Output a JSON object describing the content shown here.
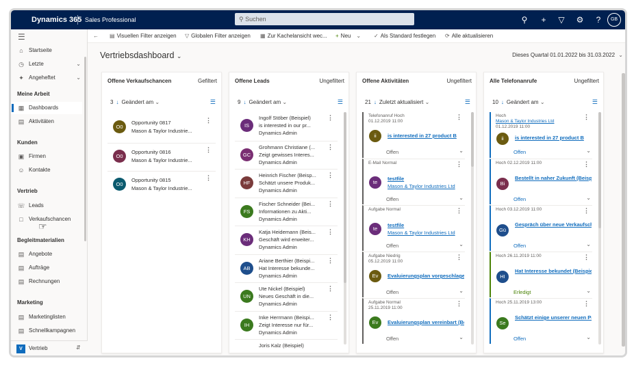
{
  "topbar": {
    "brand": "Dynamics 365",
    "app_name": "Sales Professional",
    "search_placeholder": "Suchen",
    "user_initials": "GB"
  },
  "sidebar": {
    "nav": [
      {
        "label": "Startseite",
        "icon": "home-icon"
      },
      {
        "label": "Letzte",
        "icon": "clock-icon"
      },
      {
        "label": "Angeheftet",
        "icon": "pin-icon"
      }
    ],
    "sections": [
      {
        "title": "Meine Arbeit",
        "items": [
          {
            "label": "Dashboards",
            "icon": "dashboard-icon"
          },
          {
            "label": "Aktivitäten",
            "icon": "activity-icon"
          }
        ]
      },
      {
        "title": "Kunden",
        "items": [
          {
            "label": "Firmen",
            "icon": "building-icon"
          },
          {
            "label": "Kontakte",
            "icon": "person-icon"
          }
        ]
      },
      {
        "title": "Vertrieb",
        "items": [
          {
            "label": "Leads",
            "icon": "phone-icon"
          },
          {
            "label": "Verkaufschancen",
            "icon": "opportunity-icon"
          }
        ]
      },
      {
        "title": "Begleitmaterialien",
        "items": [
          {
            "label": "Angebote",
            "icon": "quote-icon"
          },
          {
            "label": "Aufträge",
            "icon": "order-icon"
          },
          {
            "label": "Rechnungen",
            "icon": "invoice-icon"
          }
        ]
      },
      {
        "title": "Marketing",
        "items": [
          {
            "label": "Marketinglisten",
            "icon": "list-icon"
          },
          {
            "label": "Schnellkampagnen",
            "icon": "campaign-icon"
          }
        ]
      }
    ],
    "area": {
      "badge": "V",
      "label": "Vertrieb"
    }
  },
  "commandbar": {
    "visual_filter": "Visuellen Filter anzeigen",
    "global_filter": "Globalen Filter anzeigen",
    "tile_view": "Zur Kachelansicht wec...",
    "new": "Neu",
    "set_default": "Als Standard festlegen",
    "refresh_all": "Alle aktualisieren"
  },
  "dashboard": {
    "title": "Vertriebsdashboard",
    "period": "Dieses Quartal 01.01.2022 bis 31.03.2022"
  },
  "cards": [
    {
      "title": "Offene Verkaufschancen",
      "filter": "Gefiltert",
      "count": "3",
      "sort": "Geändert am",
      "records": [
        {
          "initials": "O0",
          "color": "#6b5b10",
          "line1": "Opportunity 0817",
          "line2": "Mason & Taylor Industrie..."
        },
        {
          "initials": "O0",
          "color": "#7a2e4d",
          "line1": "Opportunity 0816",
          "line2": "Mason & Taylor Industrie..."
        },
        {
          "initials": "O0",
          "color": "#0b5a6e",
          "line1": "Opportunity 0815",
          "line2": "Mason & Taylor Industrie..."
        }
      ]
    },
    {
      "title": "Offene Leads",
      "filter": "Ungefiltert",
      "count": "9",
      "sort": "Geändert am",
      "records": [
        {
          "initials": "IS",
          "color": "#6b2d7a",
          "line1": "Ingolf Stöber (Beispiel)",
          "line2": "is interested in our pr...",
          "line3": "Dynamics Admin"
        },
        {
          "initials": "GC",
          "color": "#7a2e72",
          "line1": "Grohmann Christiane (...",
          "line2": "Zeigt gewisses Interes...",
          "line3": "Dynamics Admin"
        },
        {
          "initials": "HF",
          "color": "#7a3b3b",
          "line1": "Heinrich Fischer (Beisp...",
          "line2": "Schätzt unsere Produk...",
          "line3": "Dynamics Admin"
        },
        {
          "initials": "FS",
          "color": "#3b7a1e",
          "line1": "Fischer Schneider (Bei...",
          "line2": "Informationen zu Akti...",
          "line3": "Dynamics Admin"
        },
        {
          "initials": "KH",
          "color": "#6b2d7a",
          "line1": "Katja Heidemann (Beis...",
          "line2": "Geschäft wird erweiter...",
          "line3": "Dynamics Admin"
        },
        {
          "initials": "AB",
          "color": "#1e4e8c",
          "line1": "Ariane Berthier (Beispi...",
          "line2": "Hat Interesse bekunde...",
          "line3": "Dynamics Admin"
        },
        {
          "initials": "UN",
          "color": "#3b7a1e",
          "line1": "Ute Nickel (Beispiel)",
          "line2": "Neues Geschäft in die...",
          "line3": "Dynamics Admin"
        },
        {
          "initials": "IH",
          "color": "#3b7a1e",
          "line1": "Inke Herrmann (Beispi...",
          "line2": "Zeigt Interesse nur für...",
          "line3": "Dynamics Admin"
        },
        {
          "initials": "",
          "color": "#ffffff",
          "line1": "Joris Kalz (Beispiel)",
          "line2": "",
          "line3": ""
        }
      ]
    },
    {
      "title": "Offene Aktivitäten",
      "filter": "Ungefiltert",
      "count": "21",
      "sort": "Zuletzt aktualisiert",
      "activities": [
        {
          "type": "Telefonanruf",
          "priority": "Hoch",
          "date": "01.12.2019 11:00",
          "initials": "ii",
          "color": "#6b5b10",
          "title": "is interested in 27 product B",
          "sub": "",
          "status": "Offen"
        },
        {
          "type": "E-Mail",
          "priority": "Normal",
          "date": "",
          "initials": "te",
          "color": "#6b2d7a",
          "title": "testfile",
          "sub": "Mason & Taylor Industries Ltd",
          "status": "Offen"
        },
        {
          "type": "Aufgabe",
          "priority": "Normal",
          "date": "",
          "initials": "te",
          "color": "#6b2d7a",
          "title": "testfile",
          "sub": "Mason & Taylor Industries Ltd",
          "status": "Offen"
        },
        {
          "type": "Aufgabe",
          "priority": "Niedrig",
          "date": "05.12.2019 11:00",
          "initials": "Ev",
          "color": "#6b5b10",
          "title": "Evaluierungsplan vorgeschlagen",
          "sub": "",
          "status": "Offen"
        },
        {
          "type": "Aufgabe",
          "priority": "Normal",
          "date": "25.11.2019 11:00",
          "initials": "Ev",
          "color": "#3b7a1e",
          "title": "Evaluierungsplan vereinbart (Be",
          "sub": "",
          "status": "Offen"
        }
      ]
    },
    {
      "title": "Alle Telefonanrufe",
      "filter": "Ungefiltert",
      "count": "10",
      "sort": "Geändert am",
      "calls": [
        {
          "priority": "Hoch",
          "account": "Mason & Taylor Industries Ltd",
          "date": "01.12.2019 11:00",
          "initials": "ii",
          "color": "#6b5b10",
          "title": "is interested in 27 product B",
          "status": "Offen"
        },
        {
          "priority": "Hoch",
          "account": "",
          "date": "02.12.2019 11:00",
          "initials": "Bi",
          "color": "#7a2e4d",
          "title": "Bestellt in naher Zukunft (Beispi",
          "status": "Offen"
        },
        {
          "priority": "Hoch",
          "account": "",
          "date": "03.12.2019 11:00",
          "initials": "Gü",
          "color": "#1e4e8c",
          "title": "Gespräch über neue Verkaufsch",
          "status": "Offen"
        },
        {
          "priority": "Hoch",
          "account": "",
          "date": "26.11.2019 11:00",
          "initials": "HI",
          "color": "#1e4e8c",
          "title": "Hat Interesse bekundet (Beispie",
          "status": "Erledigt"
        },
        {
          "priority": "Hoch",
          "account": "",
          "date": "25.11.2019 13:00",
          "initials": "Se",
          "color": "#3b7a1e",
          "title": "Schätzt einige unserer neuen Pr",
          "status": "Offen"
        }
      ]
    }
  ]
}
